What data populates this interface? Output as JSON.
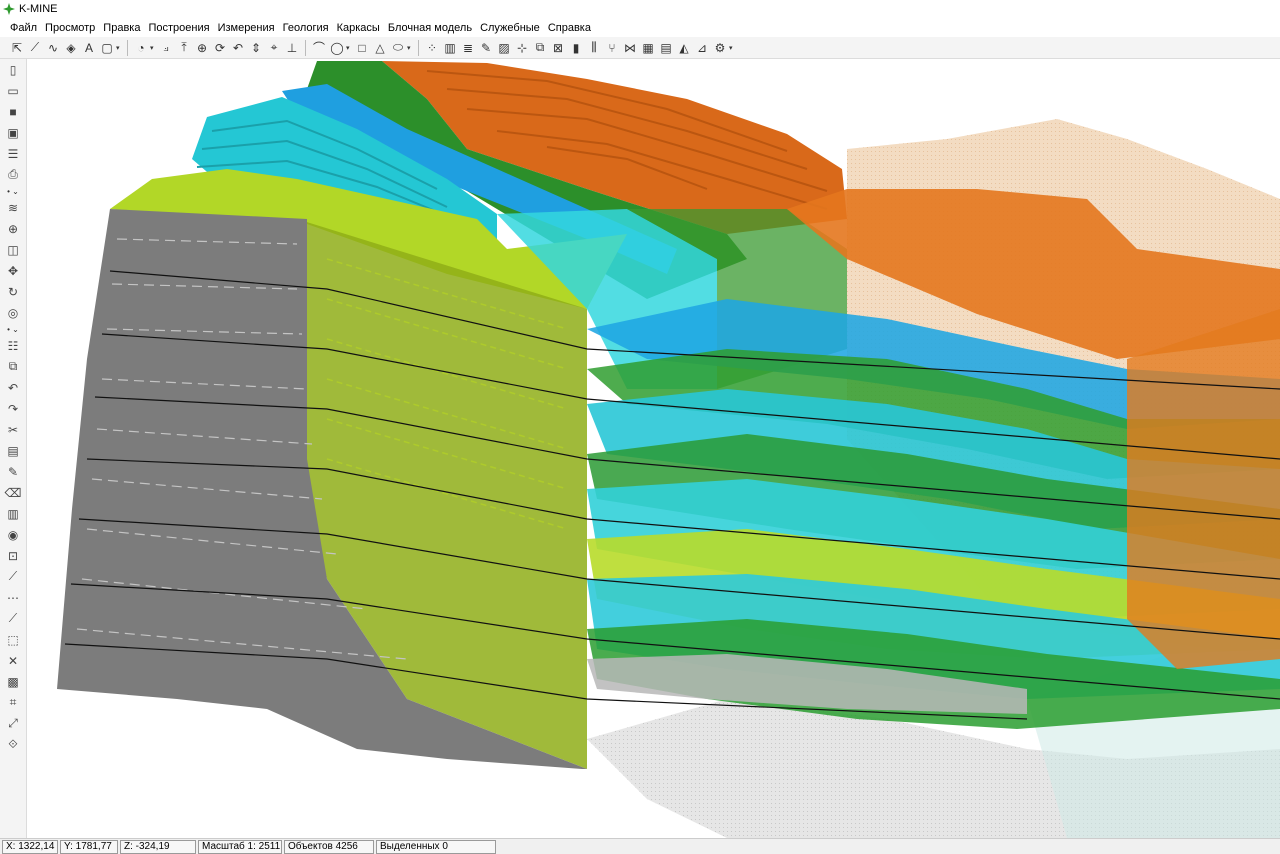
{
  "app": {
    "title": "K-MINE",
    "logo_icon": "k-mine-logo-icon"
  },
  "menu": {
    "items": [
      "Файл",
      "Просмотр",
      "Правка",
      "Построения",
      "Измерения",
      "Геология",
      "Каркасы",
      "Блочная модель",
      "Служебные",
      "Справка"
    ]
  },
  "toolbar": {
    "icons": [
      "select-arrow-icon",
      "polyline-icon",
      "spline-icon",
      "point-icon",
      "text-icon",
      "rectangle-icon",
      "circle-menu-icon",
      "node-edit-icon",
      "node-move-icon",
      "node-add-icon",
      "rotate-icon",
      "arc-icon",
      "move-icon",
      "snap-icon",
      "level-icon",
      "arc-tool-icon",
      "circle-tool-icon",
      "rectangle-tool-icon",
      "triangle-tool-icon",
      "ellipse-tool-icon",
      "scatter-icon",
      "columns-icon",
      "text-format-icon",
      "draw-tool-icon",
      "hatch-icon",
      "cursor-grid-icon",
      "copy-window-icon",
      "cross-box-icon",
      "bars-icon",
      "pipe-icon",
      "fork-icon",
      "network-icon",
      "grid-3d-icon",
      "table-icon",
      "surface-icon",
      "profile-icon",
      "settings-icon"
    ]
  },
  "left_toolbar": {
    "icons": [
      "new-file-icon",
      "open-folder-icon",
      "save-icon",
      "image-icon",
      "layers-icon",
      "print-icon",
      "layer-stack-icon",
      "globe-icon",
      "cube-icon",
      "pan-icon",
      "rotate-3d-icon",
      "orbit-icon",
      "list-icon",
      "copy-icon",
      "undo-icon",
      "redo-icon",
      "cut-icon",
      "paste-icon",
      "paint-icon",
      "eraser-icon",
      "stack-icon",
      "circle-target-icon",
      "frame-icon",
      "line-measure-icon",
      "dots-line-icon",
      "diagonal-icon",
      "select-box-icon",
      "delete-icon",
      "fill-icon",
      "crop-icon",
      "connect-icon",
      "transform-icon"
    ]
  },
  "status": {
    "x": "X: 1322,14",
    "y": "Y: 1781,77",
    "z": "Z: -324,19",
    "scale": "Масштаб 1: 2511",
    "objects": "Объектов 4256",
    "selected": "Выделенных 0"
  },
  "colors": {
    "gray_block": "#7b7b7b",
    "olive_layer": "#8faa19",
    "lime_layer": "#b5d62a",
    "green_layer": "#2f8c2a",
    "cyan_layer": "#2cd3d9",
    "blue_layer": "#21a6e0",
    "orange_layer": "#dc6a12",
    "pale_orange": "#f0cfae",
    "pale_gray": "#dcdcdc"
  }
}
